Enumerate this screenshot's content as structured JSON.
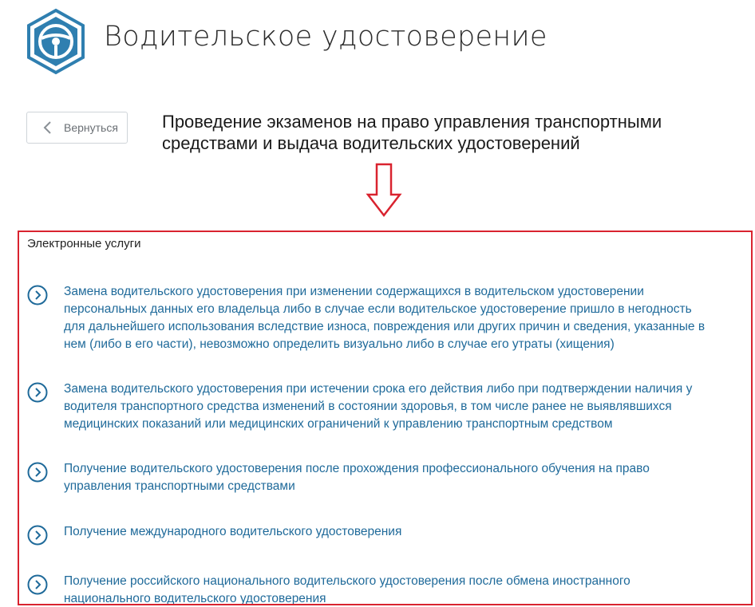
{
  "header": {
    "title": "Водительское удостоверение",
    "logo_icon": "steering-wheel-icon"
  },
  "toolbar": {
    "back_label": "Вернуться",
    "back_icon": "chevron-left-icon"
  },
  "section": {
    "heading_line1": "Проведение экзаменов на право управления транспортными",
    "heading_line2": "средствами и выдача водительских удостоверений"
  },
  "services": {
    "title": "Электронные услуги",
    "items": [
      {
        "label": "Замена водительского удостоверения при изменении содержащихся в водительском удостоверении\nперсональных данных его владельца либо в случае если водительское удостоверение пришло в негодность\nдля дальнейшего использования вследствие износа, повреждения или других причин и сведения, указанные в\nнем (либо в его части), невозможно определить визуально либо в случае его утраты (хищения)"
      },
      {
        "label": "Замена водительского удостоверения при истечении срока его действия либо при подтверждении наличия у\nводителя транспортного средства изменений в состоянии здоровья, в том числе ранее не выявлявшихся\nмедицинских показаний или медицинских ограничений к управлению транспортным средством"
      },
      {
        "label": "Получение водительского удостоверения после прохождения профессионального обучения на право\nуправления транспортными средствами"
      },
      {
        "label": "Получение международного водительского удостоверения"
      },
      {
        "label": "Получение российского национального водительского удостоверения после обмена иностранного\nнационального водительского удостоверения"
      }
    ]
  },
  "colors": {
    "accent": "#1f6a9a",
    "logo": "#2f7fb0",
    "highlight": "#d9232f"
  }
}
